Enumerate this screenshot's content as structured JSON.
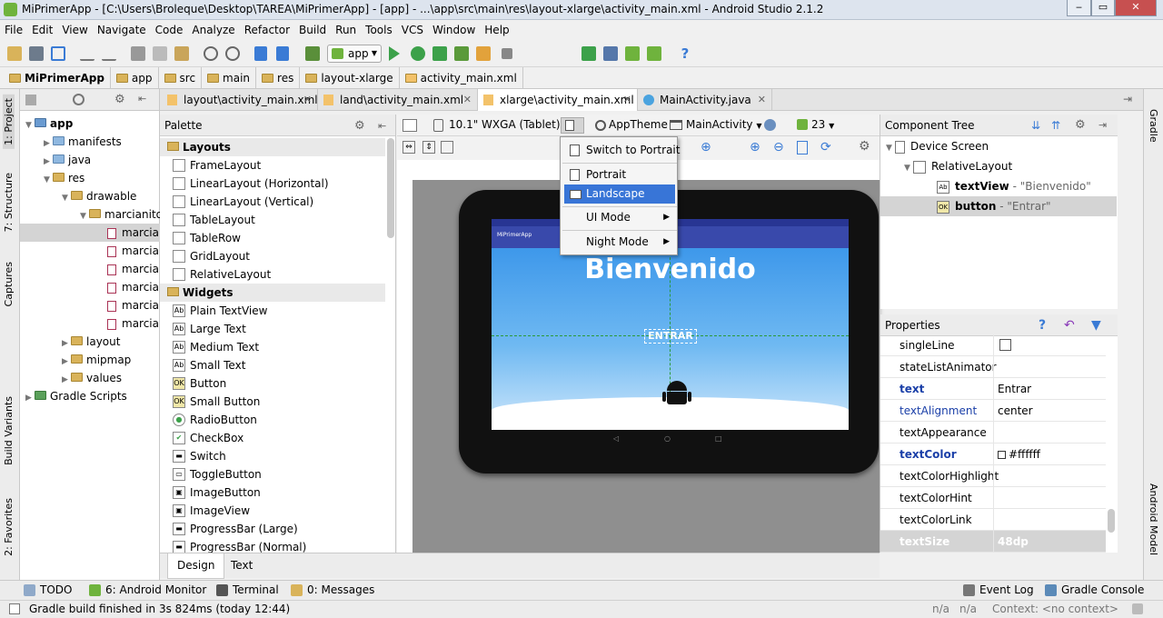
{
  "window": {
    "title": "MiPrimerApp - [C:\\Users\\Broleque\\Desktop\\TAREA\\MiPrimerApp] - [app] - ...\\app\\src\\main\\res\\layout-xlarge\\activity_main.xml - Android Studio 2.1.2",
    "minimize": "‒",
    "maximize": "▭",
    "close": "✕"
  },
  "menu": [
    "File",
    "Edit",
    "View",
    "Navigate",
    "Code",
    "Analyze",
    "Refactor",
    "Build",
    "Run",
    "Tools",
    "VCS",
    "Window",
    "Help"
  ],
  "toolbar": {
    "run_config": "app"
  },
  "breadcrumbs": [
    "MiPrimerApp",
    "app",
    "src",
    "main",
    "res",
    "layout-xlarge",
    "activity_main.xml"
  ],
  "left_stripe": {
    "project": "1: Project",
    "structure": "7: Structure",
    "captures": "Captures",
    "build_variants": "Build Variants",
    "favorites": "2: Favorites"
  },
  "right_stripe": {
    "gradle": "Gradle",
    "android_model": "Android Model"
  },
  "project_tree": [
    {
      "label": "app",
      "level": 0,
      "bold": true
    },
    {
      "label": "manifests",
      "level": 1
    },
    {
      "label": "java",
      "level": 1
    },
    {
      "label": "res",
      "level": 1
    },
    {
      "label": "drawable",
      "level": 2
    },
    {
      "label": "marcianito",
      "level": 3
    },
    {
      "label": "marcia",
      "level": 4
    },
    {
      "label": "marcia",
      "level": 4
    },
    {
      "label": "marcia",
      "level": 4
    },
    {
      "label": "marcia",
      "level": 4
    },
    {
      "label": "marcia",
      "level": 4
    },
    {
      "label": "marcia",
      "level": 4
    },
    {
      "label": "layout",
      "level": 2
    },
    {
      "label": "mipmap",
      "level": 2
    },
    {
      "label": "values",
      "level": 2
    },
    {
      "label": "Gradle Scripts",
      "level": 0
    }
  ],
  "editor_tabs": [
    "layout\\activity_main.xml",
    "land\\activity_main.xml",
    "xlarge\\activity_main.xml",
    "MainActivity.java"
  ],
  "palette": {
    "title": "Palette",
    "sections": {
      "layouts": "Layouts",
      "widgets": "Widgets"
    },
    "layouts": [
      "FrameLayout",
      "LinearLayout (Horizontal)",
      "LinearLayout (Vertical)",
      "TableLayout",
      "TableRow",
      "GridLayout",
      "RelativeLayout"
    ],
    "widgets": [
      "Plain TextView",
      "Large Text",
      "Medium Text",
      "Small Text",
      "Button",
      "Small Button",
      "RadioButton",
      "CheckBox",
      "Switch",
      "ToggleButton",
      "ImageButton",
      "ImageView",
      "ProgressBar (Large)",
      "ProgressBar (Normal)"
    ]
  },
  "design_tabs": {
    "design": "Design",
    "text": "Text"
  },
  "designer": {
    "device": "10.1\" WXGA (Tablet)",
    "theme": "AppTheme",
    "activity": "MainActivity",
    "api": "23",
    "app_title": "MiPrimerApp",
    "heading": "Bienvenido",
    "button_text": "ENTRAR"
  },
  "orientation_menu": {
    "switch": "Switch to Portrait",
    "portrait": "Portrait",
    "landscape": "Landscape",
    "ui_mode": "UI Mode",
    "night_mode": "Night Mode"
  },
  "component_tree": {
    "title": "Component Tree",
    "device_screen": "Device Screen",
    "relative_layout": "RelativeLayout",
    "textview_id": "textView",
    "textview_hint": "- \"Bienvenido\"",
    "button_id": "button",
    "button_hint": "- \"Entrar\""
  },
  "properties": {
    "title": "Properties",
    "rows": [
      {
        "name": "singleLine",
        "value": ""
      },
      {
        "name": "stateListAnimator",
        "value": ""
      },
      {
        "name": "text",
        "value": "Entrar"
      },
      {
        "name": "textAlignment",
        "value": "center"
      },
      {
        "name": "textAppearance",
        "value": ""
      },
      {
        "name": "textColor",
        "value": "#ffffff"
      },
      {
        "name": "textColorHighlight",
        "value": ""
      },
      {
        "name": "textColorHint",
        "value": ""
      },
      {
        "name": "textColorLink",
        "value": ""
      },
      {
        "name": "textSize",
        "value": "48dp"
      }
    ]
  },
  "bottom_tools": {
    "todo": "TODO",
    "android_monitor": "6: Android Monitor",
    "terminal": "Terminal",
    "messages": "0: Messages",
    "event_log": "Event Log",
    "gradle_console": "Gradle Console"
  },
  "status": {
    "message": "Gradle build finished in 3s 824ms (today 12:44)",
    "pos1": "n/a",
    "pos2": "n/a",
    "context": "Context: <no context>"
  },
  "colors": {
    "accent": "#3875d7",
    "app_bar": "#3949ab",
    "status_bar": "#283593"
  }
}
